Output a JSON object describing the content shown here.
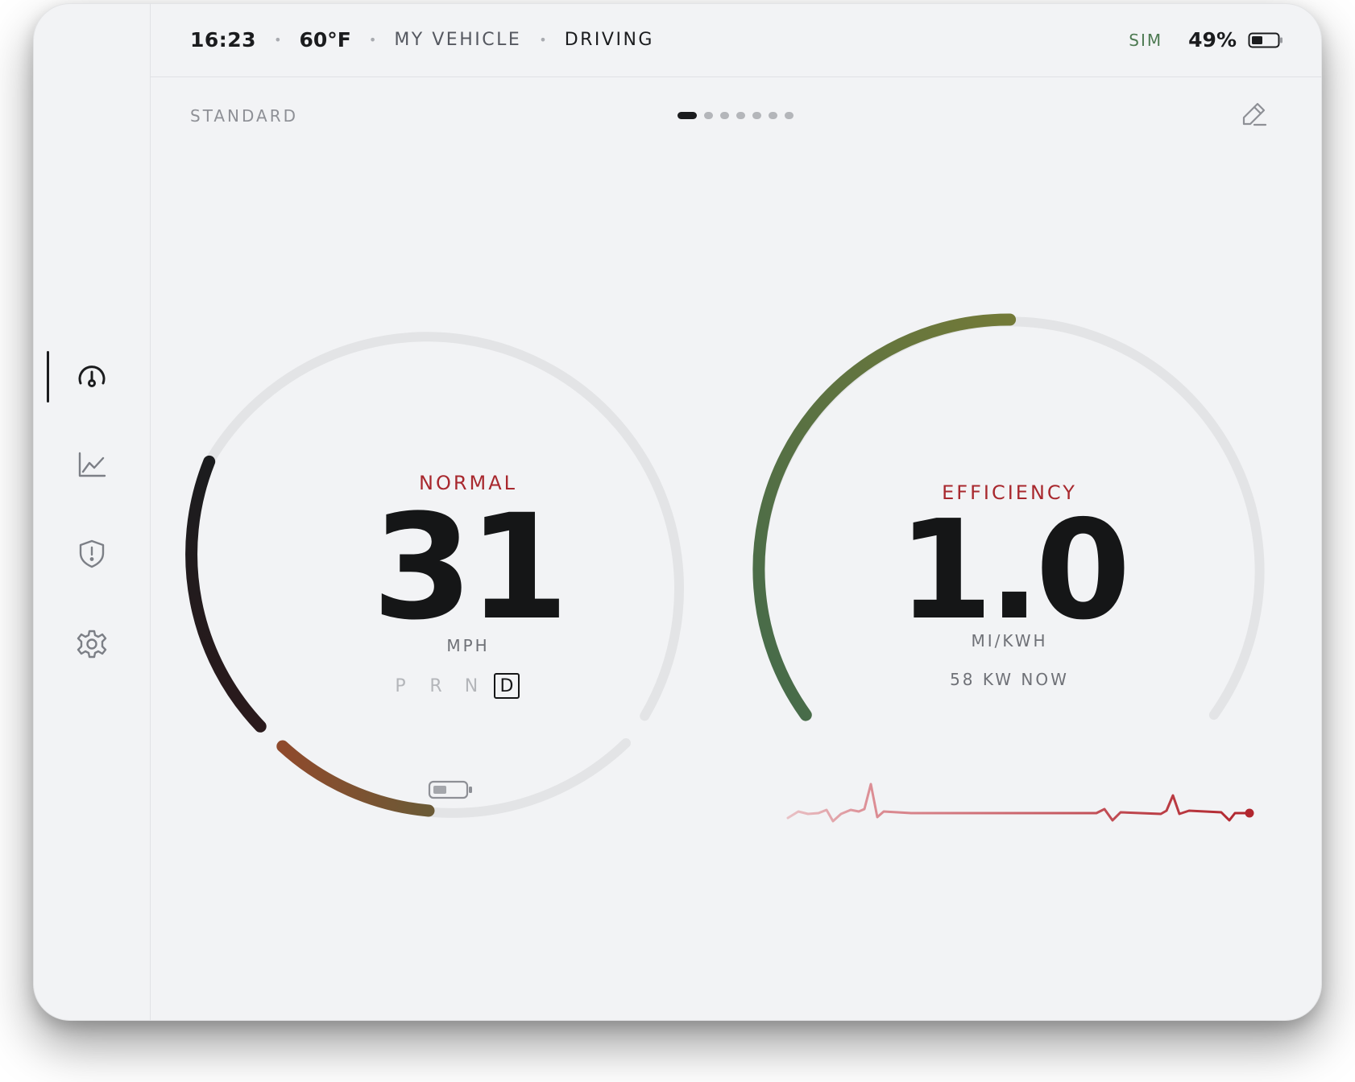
{
  "status": {
    "time": "16:23",
    "temperature": "60°F",
    "vehicle": "MY VEHICLE",
    "mode": "DRIVING",
    "sim": "SIM",
    "battery_percent": "49%"
  },
  "header": {
    "profile": "STANDARD",
    "page_count": 7,
    "active_page": 0
  },
  "sidebar": {
    "items": [
      {
        "icon": "gauge-icon",
        "active": true
      },
      {
        "icon": "chart-icon",
        "active": false
      },
      {
        "icon": "shield-alert-icon",
        "active": false
      },
      {
        "icon": "gear-icon",
        "active": false
      }
    ]
  },
  "speed_gauge": {
    "mode_label": "NORMAL",
    "speed": "31",
    "unit": "MPH",
    "gears": [
      "P",
      "R",
      "N",
      "D"
    ],
    "selected_gear": "D"
  },
  "efficiency_gauge": {
    "label": "EFFICIENCY",
    "value": "1.0",
    "unit": "MI/KWH",
    "power": "58 KW NOW"
  },
  "colors": {
    "accent_red": "#a8282e",
    "efficiency_green": "#4d7a52",
    "track": "#e3e4e6",
    "text_dark": "#151617"
  }
}
